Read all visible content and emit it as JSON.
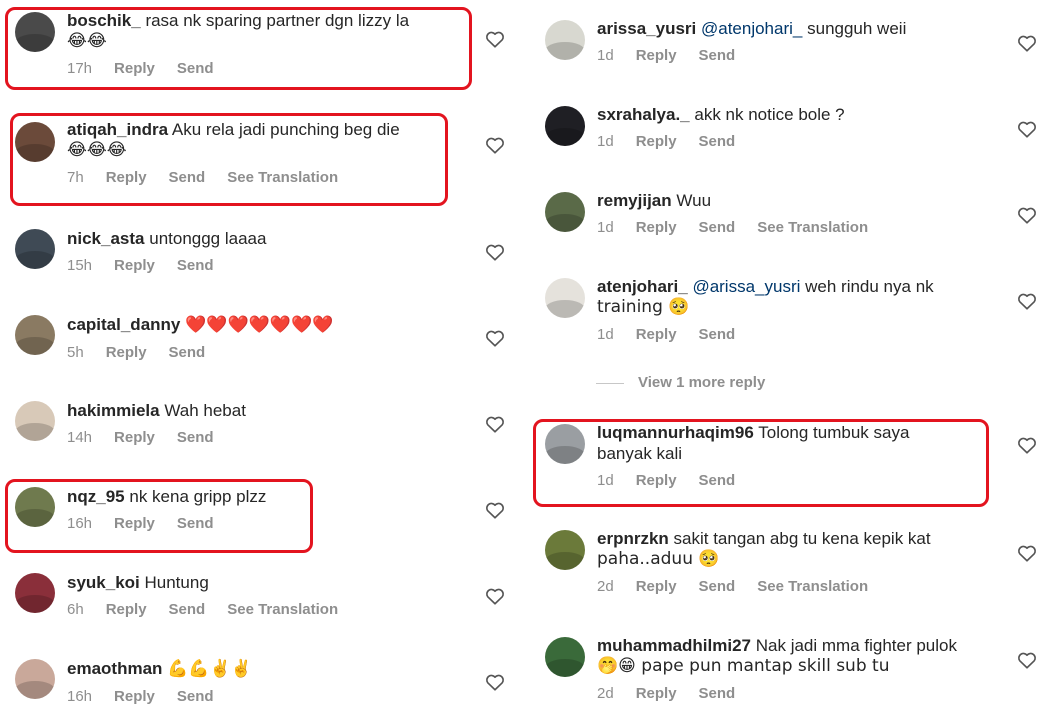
{
  "left_comments": [
    {
      "username": "boschik_",
      "mention": "",
      "text": "rasa nk sparing partner dgn lizzy la",
      "text2": "😂😂",
      "time": "17h",
      "reply": "Reply",
      "send": "Send",
      "translate": "",
      "avatar_color": "#4a4a4a"
    },
    {
      "username": "atiqah_indra",
      "mention": "",
      "text": "Aku rela jadi punching beg die",
      "text2": "😂😂😂",
      "time": "7h",
      "reply": "Reply",
      "send": "Send",
      "translate": "See Translation",
      "avatar_color": "#6b4a3a"
    },
    {
      "username": "nick_asta",
      "mention": "",
      "text": "untonggg laaaa",
      "text2": "",
      "time": "15h",
      "reply": "Reply",
      "send": "Send",
      "translate": "",
      "avatar_color": "#3f4a55"
    },
    {
      "username": "capital_danny",
      "mention": "",
      "text": "❤️❤️❤️❤️❤️❤️❤️",
      "text2": "",
      "time": "5h",
      "reply": "Reply",
      "send": "Send",
      "translate": "",
      "avatar_color": "#8a7a62"
    },
    {
      "username": "hakimmiela",
      "mention": "",
      "text": "Wah hebat",
      "text2": "",
      "time": "14h",
      "reply": "Reply",
      "send": "Send",
      "translate": "",
      "avatar_color": "#d8c9b8"
    },
    {
      "username": "nqz_95",
      "mention": "",
      "text": "nk kena gripp plzz",
      "text2": "",
      "time": "16h",
      "reply": "Reply",
      "send": "Send",
      "translate": "",
      "avatar_color": "#6f7a4e"
    },
    {
      "username": "syuk_koi",
      "mention": "",
      "text": "Huntung",
      "text2": "",
      "time": "6h",
      "reply": "Reply",
      "send": "Send",
      "translate": "See Translation",
      "avatar_color": "#8a2f3a"
    },
    {
      "username": "emaothman",
      "mention": "",
      "text": "💪💪✌️✌️",
      "text2": "",
      "time": "16h",
      "reply": "Reply",
      "send": "Send",
      "translate": "",
      "avatar_color": "#c9a89a"
    }
  ],
  "right_comments": [
    {
      "username": "arissa_yusri",
      "mention": "@atenjohari_",
      "text": "sungguh weii",
      "text2": "",
      "time": "1d",
      "reply": "Reply",
      "send": "Send",
      "translate": "",
      "avatar_color": "#d8d8d0"
    },
    {
      "username": "sxrahalya._",
      "mention": "",
      "text": "akk nk notice bole ?",
      "text2": "",
      "time": "1d",
      "reply": "Reply",
      "send": "Send",
      "translate": "",
      "avatar_color": "#1f1f24"
    },
    {
      "username": "remyjijan",
      "mention": "",
      "text": "Wuu",
      "text2": "",
      "time": "1d",
      "reply": "Reply",
      "send": "Send",
      "translate": "See Translation",
      "avatar_color": "#5a6a48"
    },
    {
      "username": "atenjohari_",
      "mention": "@arissa_yusri",
      "text": " weh rindu nya nk",
      "text2": "training 🥺",
      "time": "1d",
      "reply": "Reply",
      "send": "Send",
      "translate": "",
      "avatar_color": "#e5e2dc"
    },
    {
      "username": "luqmannurhaqim96",
      "mention": "",
      "text": "Tolong tumbuk saya",
      "text2": "banyak kali",
      "time": "1d",
      "reply": "Reply",
      "send": "Send",
      "translate": "",
      "avatar_color": "#9a9ea2"
    },
    {
      "username": "erpnrzkn",
      "mention": "",
      "text": "sakit tangan abg tu kena kepik kat",
      "text2": "paha..aduu 🥺",
      "time": "2d",
      "reply": "Reply",
      "send": "Send",
      "translate": "See Translation",
      "avatar_color": "#6b7a3a"
    },
    {
      "username": "muhammadhilmi27",
      "mention": "",
      "text": "Nak jadi mma fighter pulok",
      "text2": "🤭😁 pape pun mantap skill sub tu",
      "time": "2d",
      "reply": "Reply",
      "send": "Send",
      "translate": "",
      "avatar_color": "#3a6a3a"
    }
  ],
  "view_more": "View 1 more reply",
  "highlight_color": "#e3141f"
}
